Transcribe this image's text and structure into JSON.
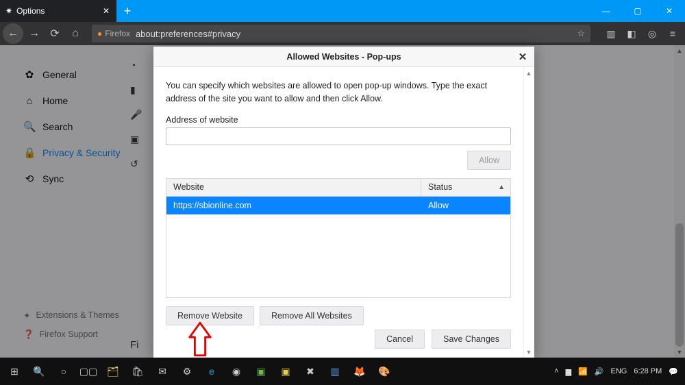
{
  "tab": {
    "title": "Options"
  },
  "url": {
    "identity": "Firefox",
    "path": "about:preferences#privacy"
  },
  "sidebar": {
    "items": [
      {
        "label": "General"
      },
      {
        "label": "Home"
      },
      {
        "label": "Search"
      },
      {
        "label": "Privacy & Security"
      },
      {
        "label": "Sync"
      }
    ],
    "footer": [
      {
        "label": "Extensions & Themes"
      },
      {
        "label": "Firefox Support"
      }
    ]
  },
  "dialog": {
    "title": "Allowed Websites - Pop-ups",
    "desc": "You can specify which websites are allowed to open pop-up windows. Type the exact address of the site you want to allow and then click Allow.",
    "address_label": "Address of website",
    "allow_btn": "Allow",
    "columns": {
      "website": "Website",
      "status": "Status"
    },
    "rows": [
      {
        "website": "https://sbionline.com",
        "status": "Allow"
      }
    ],
    "remove_btn": "Remove Website",
    "remove_all_btn": "Remove All Websites",
    "cancel_btn": "Cancel",
    "save_btn": "Save Changes"
  },
  "tray": {
    "lang": "ENG",
    "time": "6:28 PM"
  }
}
